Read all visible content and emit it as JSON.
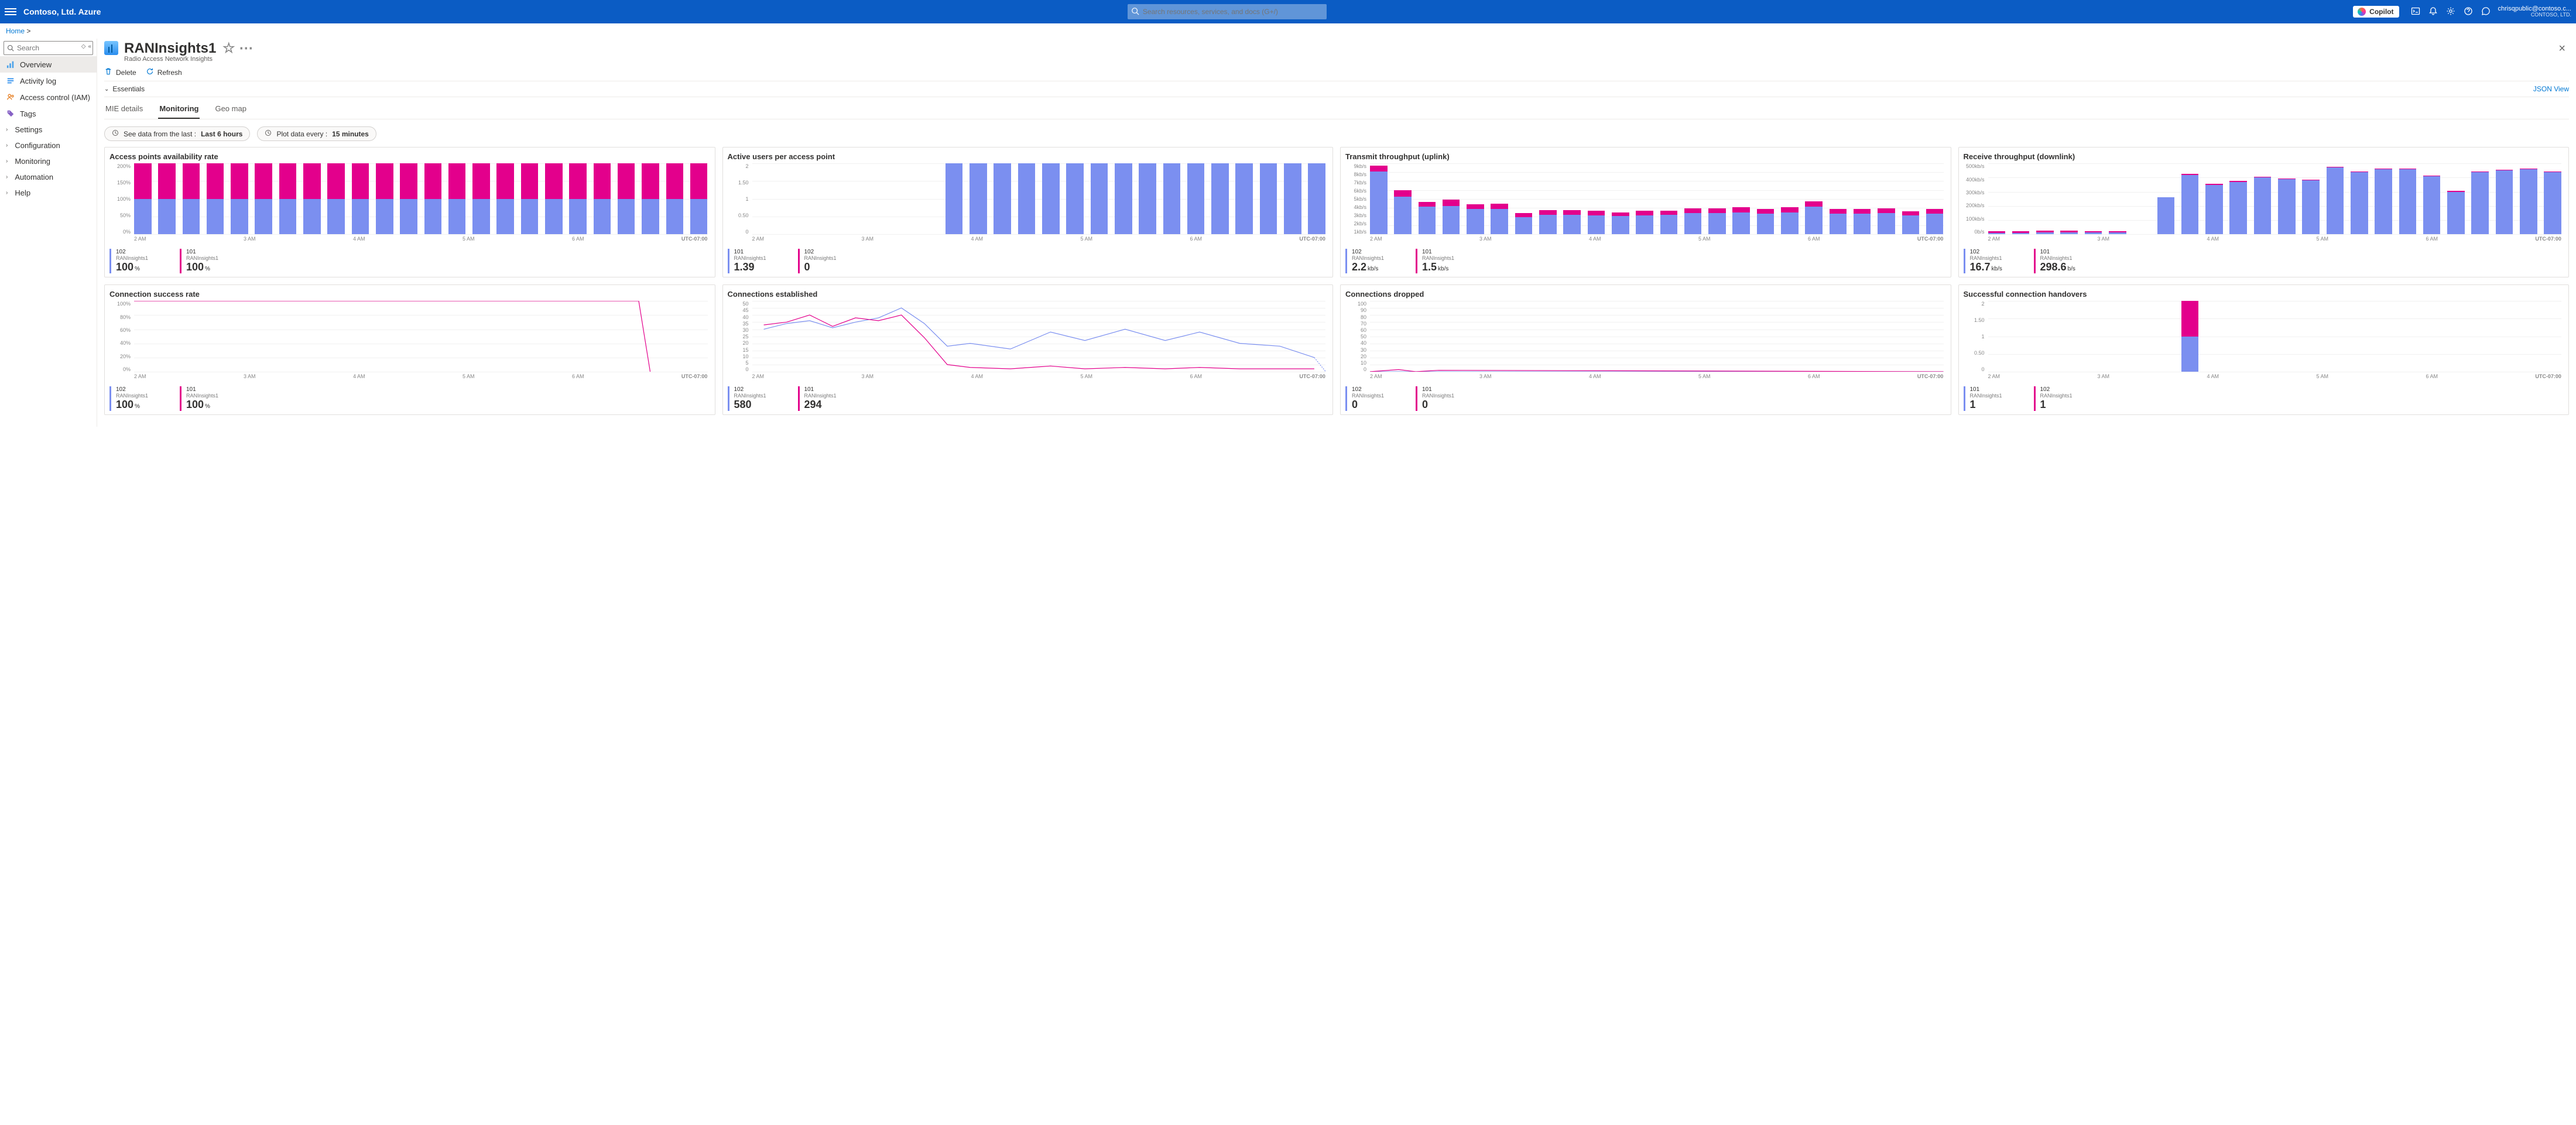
{
  "topbar": {
    "brand": "Contoso, Ltd. Azure",
    "search_placeholder": "Search resources, services, and docs (G+/)",
    "copilot_label": "Copilot",
    "account_name": "chrisqpublic@contoso.c...",
    "account_tenant": "CONTOSO, LTD."
  },
  "breadcrumb": {
    "home": "Home"
  },
  "resource": {
    "title": "RANInsights1",
    "subtitle": "Radio Access Network Insights"
  },
  "sidebar": {
    "search_placeholder": "Search",
    "items": [
      {
        "label": "Overview",
        "icon": "overview"
      },
      {
        "label": "Activity log",
        "icon": "activitylog"
      },
      {
        "label": "Access control (IAM)",
        "icon": "access"
      },
      {
        "label": "Tags",
        "icon": "tags"
      },
      {
        "label": "Settings",
        "icon": "chevron"
      },
      {
        "label": "Configuration",
        "icon": "chevron"
      },
      {
        "label": "Monitoring",
        "icon": "chevron"
      },
      {
        "label": "Automation",
        "icon": "chevron"
      },
      {
        "label": "Help",
        "icon": "chevron"
      }
    ]
  },
  "toolbar": {
    "delete": "Delete",
    "refresh": "Refresh"
  },
  "essentials_label": "Essentials",
  "json_view": "JSON View",
  "tabs": {
    "mie": "MIE details",
    "monitoring": "Monitoring",
    "geomap": "Geo map"
  },
  "pills": {
    "data_prefix": "See data from the last : ",
    "data_value": "Last 6 hours",
    "plot_prefix": "Plot data every : ",
    "plot_value": "15 minutes"
  },
  "xticks": [
    "2 AM",
    "3 AM",
    "4 AM",
    "5 AM",
    "6 AM"
  ],
  "utc": "UTC-07:00",
  "cards": [
    {
      "title": "Access points availability rate",
      "stats": [
        {
          "id": "102",
          "src": "RANInsights1",
          "val": "100",
          "unit": "%",
          "blue": true
        },
        {
          "id": "101",
          "src": "RANInsights1",
          "val": "100",
          "unit": "%"
        }
      ]
    },
    {
      "title": "Active users per access point",
      "stats": [
        {
          "id": "101",
          "src": "RANInsights1",
          "val": "1.39",
          "unit": "",
          "blue": true
        },
        {
          "id": "102",
          "src": "RANInsights1",
          "val": "0",
          "unit": ""
        }
      ]
    },
    {
      "title": "Transmit throughput (uplink)",
      "stats": [
        {
          "id": "102",
          "src": "RANInsights1",
          "val": "2.2",
          "unit": "kb/s",
          "blue": true
        },
        {
          "id": "101",
          "src": "RANInsights1",
          "val": "1.5",
          "unit": "kb/s"
        }
      ]
    },
    {
      "title": "Receive throughput (downlink)",
      "stats": [
        {
          "id": "102",
          "src": "RANInsights1",
          "val": "16.7",
          "unit": "kb/s",
          "blue": true
        },
        {
          "id": "101",
          "src": "RANInsights1",
          "val": "298.6",
          "unit": "b/s"
        }
      ]
    },
    {
      "title": "Connection success rate",
      "stats": [
        {
          "id": "102",
          "src": "RANInsights1",
          "val": "100",
          "unit": "%",
          "blue": true
        },
        {
          "id": "101",
          "src": "RANInsights1",
          "val": "100",
          "unit": "%"
        }
      ]
    },
    {
      "title": "Connections established",
      "stats": [
        {
          "id": "102",
          "src": "RANInsights1",
          "val": "580",
          "unit": "",
          "blue": true
        },
        {
          "id": "101",
          "src": "RANInsights1",
          "val": "294",
          "unit": ""
        }
      ]
    },
    {
      "title": "Connections dropped",
      "stats": [
        {
          "id": "102",
          "src": "RANInsights1",
          "val": "0",
          "unit": "",
          "blue": true
        },
        {
          "id": "101",
          "src": "RANInsights1",
          "val": "0",
          "unit": ""
        }
      ]
    },
    {
      "title": "Successful connection handovers",
      "stats": [
        {
          "id": "101",
          "src": "RANInsights1",
          "val": "1",
          "unit": "",
          "blue": true
        },
        {
          "id": "102",
          "src": "RANInsights1",
          "val": "1",
          "unit": ""
        }
      ]
    }
  ],
  "chart_data": [
    {
      "type": "bar",
      "title": "Access points availability rate",
      "xlabel": "",
      "ylabel": "%",
      "ylim": [
        0,
        200
      ],
      "yticks": [
        "200%",
        "150%",
        "100%",
        "50%",
        "0%"
      ],
      "n": 24,
      "series": [
        {
          "name": "102",
          "color": "blue",
          "const": 100
        },
        {
          "name": "101",
          "color": "pink",
          "const": 100
        }
      ]
    },
    {
      "type": "bar",
      "title": "Active users per access point",
      "xlabel": "",
      "ylabel": "",
      "ylim": [
        0,
        2
      ],
      "yticks": [
        "2",
        "1.50",
        "1",
        "0.50",
        "0"
      ],
      "n": 24,
      "series": [
        {
          "name": "101",
          "color": "blue",
          "values": [
            0,
            0,
            0,
            0,
            0,
            0,
            0,
            0,
            2,
            2,
            2,
            2,
            2,
            2,
            2,
            2,
            2,
            2,
            2,
            2,
            2,
            2,
            2,
            2
          ]
        },
        {
          "name": "102",
          "color": "pink",
          "values": [
            0,
            0,
            0,
            0,
            0,
            0,
            0,
            0,
            0,
            0,
            0,
            0,
            0,
            0,
            0,
            0,
            0,
            0,
            0,
            0,
            0,
            0,
            0,
            0
          ]
        }
      ]
    },
    {
      "type": "bar",
      "title": "Transmit throughput (uplink)",
      "xlabel": "",
      "ylabel": "kb/s",
      "ylim": [
        0,
        9
      ],
      "yticks": [
        "9kb/s",
        "8kb/s",
        "7kb/s",
        "6kb/s",
        "5kb/s",
        "4kb/s",
        "3kb/s",
        "2kb/s",
        "1kb/s"
      ],
      "n": 24,
      "series": [
        {
          "name": "102",
          "color": "blue",
          "values": [
            8.0,
            4.8,
            3.5,
            3.6,
            3.2,
            3.2,
            2.2,
            2.5,
            2.5,
            2.4,
            2.3,
            2.4,
            2.5,
            2.7,
            2.7,
            2.8,
            2.6,
            2.8,
            3.5,
            2.6,
            2.6,
            2.7,
            2.4,
            2.6
          ]
        },
        {
          "name": "101",
          "color": "pink",
          "values": [
            0.7,
            0.8,
            0.6,
            0.8,
            0.6,
            0.7,
            0.5,
            0.6,
            0.6,
            0.6,
            0.5,
            0.6,
            0.5,
            0.6,
            0.6,
            0.6,
            0.6,
            0.6,
            0.7,
            0.6,
            0.6,
            0.6,
            0.5,
            0.6
          ]
        }
      ]
    },
    {
      "type": "bar",
      "title": "Receive throughput (downlink)",
      "xlabel": "",
      "ylabel": "kb/s",
      "ylim": [
        0,
        500
      ],
      "yticks": [
        "500kb/s",
        "400kb/s",
        "300kb/s",
        "200kb/s",
        "100kb/s",
        "0b/s"
      ],
      "n": 24,
      "series": [
        {
          "name": "102",
          "color": "blue",
          "values": [
            10,
            10,
            15,
            15,
            12,
            12,
            0,
            260,
            420,
            350,
            370,
            400,
            390,
            380,
            470,
            440,
            460,
            460,
            410,
            300,
            440,
            450,
            460,
            440
          ]
        },
        {
          "name": "101",
          "color": "pink",
          "values": [
            10,
            10,
            10,
            10,
            10,
            10,
            0,
            0,
            5,
            5,
            5,
            5,
            5,
            5,
            5,
            5,
            5,
            5,
            5,
            5,
            5,
            5,
            5,
            5
          ]
        }
      ]
    },
    {
      "type": "line",
      "title": "Connection success rate",
      "xlabel": "",
      "ylabel": "%",
      "ylim": [
        0,
        100
      ],
      "yticks": [
        "100%",
        "80%",
        "60%",
        "40%",
        "20%",
        "0%"
      ],
      "series": [
        {
          "name": "101",
          "color": "pink",
          "x": [
            0,
            0.88,
            0.9
          ],
          "y": [
            100,
            100,
            0
          ]
        }
      ]
    },
    {
      "type": "line",
      "title": "Connections established",
      "xlabel": "",
      "ylabel": "",
      "ylim": [
        0,
        50
      ],
      "yticks": [
        "50",
        "45",
        "40",
        "35",
        "30",
        "25",
        "20",
        "15",
        "10",
        "5",
        "0"
      ],
      "series": [
        {
          "name": "102",
          "color": "blue",
          "x": [
            0.02,
            0.06,
            0.1,
            0.14,
            0.18,
            0.22,
            0.26,
            0.3,
            0.34,
            0.38,
            0.45,
            0.52,
            0.58,
            0.65,
            0.72,
            0.78,
            0.85,
            0.92,
            0.98
          ],
          "y": [
            30,
            34,
            36,
            31,
            35,
            38,
            45,
            34,
            18,
            20,
            16,
            28,
            22,
            30,
            22,
            28,
            20,
            18,
            10
          ]
        },
        {
          "name": "101",
          "color": "pink",
          "x": [
            0.02,
            0.06,
            0.1,
            0.14,
            0.18,
            0.22,
            0.26,
            0.3,
            0.34,
            0.38,
            0.45,
            0.52,
            0.58,
            0.65,
            0.72,
            0.78,
            0.85,
            0.92,
            0.98
          ],
          "y": [
            33,
            35,
            40,
            32,
            38,
            36,
            40,
            24,
            5,
            3,
            2,
            4,
            2,
            3,
            2,
            3,
            2,
            2,
            2
          ]
        }
      ]
    },
    {
      "type": "line",
      "title": "Connections dropped",
      "xlabel": "",
      "ylabel": "",
      "ylim": [
        0,
        100
      ],
      "yticks": [
        "100",
        "90",
        "80",
        "70",
        "60",
        "50",
        "40",
        "30",
        "20",
        "10",
        "0"
      ],
      "series": [
        {
          "name": "102",
          "color": "blue",
          "x": [
            0,
            1
          ],
          "y": [
            0,
            0
          ]
        },
        {
          "name": "101",
          "color": "pink",
          "x": [
            0,
            0.05,
            0.08,
            0.12,
            1
          ],
          "y": [
            0,
            3,
            0,
            2,
            0
          ]
        }
      ]
    },
    {
      "type": "bar",
      "title": "Successful connection handovers",
      "xlabel": "",
      "ylabel": "",
      "ylim": [
        0,
        2
      ],
      "yticks": [
        "2",
        "1.50",
        "1",
        "0.50",
        "0"
      ],
      "n": 24,
      "series": [
        {
          "name": "101",
          "color": "blue",
          "values": [
            0,
            0,
            0,
            0,
            0,
            0,
            0,
            0,
            1,
            0,
            0,
            0,
            0,
            0,
            0,
            0,
            0,
            0,
            0,
            0,
            0,
            0,
            0,
            0
          ]
        },
        {
          "name": "102",
          "color": "pink",
          "values": [
            0,
            0,
            0,
            0,
            0,
            0,
            0,
            0,
            1,
            0,
            0,
            0,
            0,
            0,
            0,
            0,
            0,
            0,
            0,
            0,
            0,
            0,
            0,
            0
          ]
        }
      ]
    }
  ]
}
